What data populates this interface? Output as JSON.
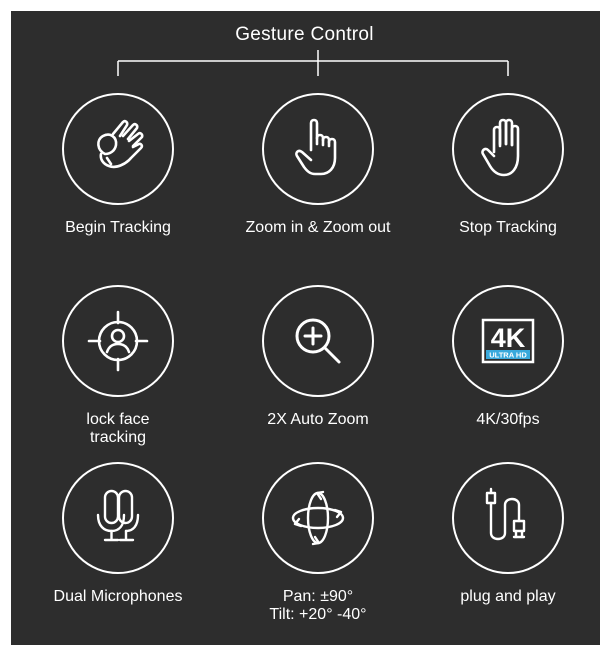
{
  "title": "Gesture Control",
  "colors": {
    "panel_background": "#2d2d2d",
    "foreground": "#ffffff",
    "badge_accent": "#39a9dc"
  },
  "features": [
    {
      "icon": "ok-hand-icon",
      "label_lines": [
        "Begin Tracking"
      ]
    },
    {
      "icon": "pointing-finger-icon",
      "label_lines": [
        "Zoom in & Zoom out"
      ]
    },
    {
      "icon": "open-palm-icon",
      "label_lines": [
        "Stop Tracking"
      ]
    },
    {
      "icon": "face-target-icon",
      "label_lines": [
        "lock face",
        "tracking"
      ]
    },
    {
      "icon": "zoom-in-icon",
      "label_lines": [
        "2X Auto Zoom"
      ]
    },
    {
      "icon": "4k-badge-icon",
      "badge_main": "4K",
      "badge_sub": "ULTRA HD",
      "label_lines": [
        "4K/30fps"
      ]
    },
    {
      "icon": "dual-microphone-icon",
      "label_lines": [
        "Dual Microphones"
      ]
    },
    {
      "icon": "pan-tilt-rotation-icon",
      "label_lines": [
        "Pan: ±90°",
        "Tilt: +20°  -40°"
      ]
    },
    {
      "icon": "usb-cable-icon",
      "label_lines": [
        "plug and play"
      ]
    }
  ]
}
